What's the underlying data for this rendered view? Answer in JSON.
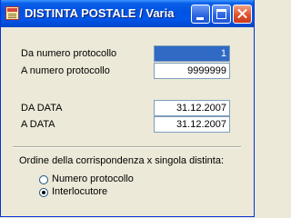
{
  "window": {
    "title": "DISTINTA POSTALE / Varia"
  },
  "form": {
    "da_numero_label": "Da numero protocollo",
    "da_numero_value": "1",
    "a_numero_label": "A  numero protocollo",
    "a_numero_value": "9999999",
    "da_data_label": "DA DATA",
    "da_data_value": "31.12.2007",
    "a_data_label": "A DATA",
    "a_data_value": "31.12.2007"
  },
  "order": {
    "heading": "Ordine della corrispondenza x singola distinta:",
    "options": [
      {
        "label": "Numero protocollo",
        "checked": false
      },
      {
        "label": "Interlocutore",
        "checked": true
      }
    ]
  },
  "colors": {
    "title_bar": "#0054E3",
    "window_bg": "#ECE9D8",
    "selection": "#316AC5"
  }
}
